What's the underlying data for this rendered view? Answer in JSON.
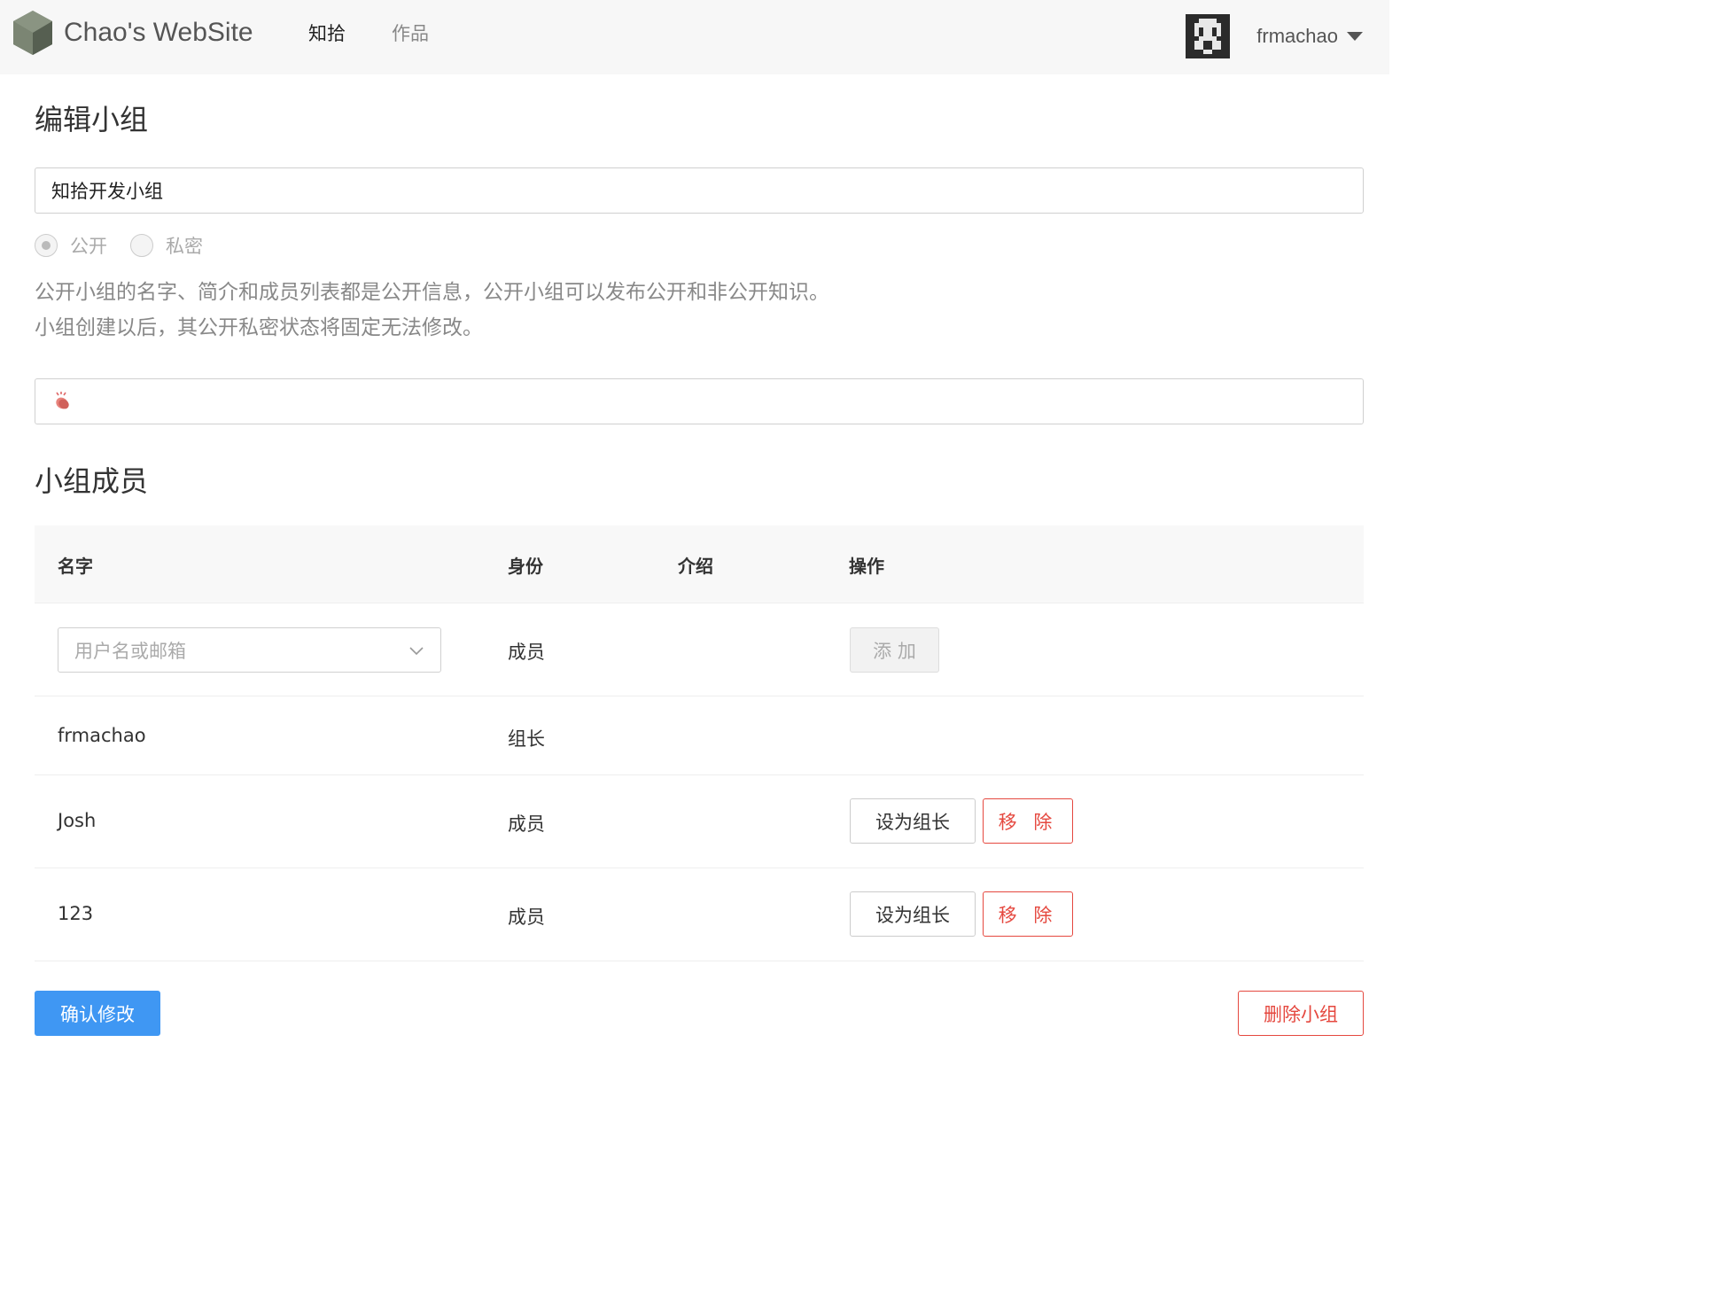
{
  "navbar": {
    "brand": "Chao's WebSite",
    "links": [
      {
        "label": "知拾",
        "active": true
      },
      {
        "label": "作品",
        "active": false
      }
    ],
    "username": "frmachao"
  },
  "form": {
    "title": "编辑小组",
    "group_name_value": "知拾开发小组",
    "visibility": {
      "options": [
        "公开",
        "私密"
      ],
      "selected": "公开",
      "disabled": true
    },
    "help_line_1": "公开小组的名字、简介和成员列表都是公开信息，公开小组可以发布公开和非公开知识。",
    "help_line_2": "小组创建以后，其公开私密状态将固定无法修改。",
    "description_icon": "clapping-hands-icon"
  },
  "members": {
    "title": "小组成员",
    "columns": [
      "名字",
      "身份",
      "介绍",
      "操作"
    ],
    "add_row": {
      "placeholder": "用户名或邮箱",
      "role": "成员",
      "add_label": "添 加"
    },
    "rows": [
      {
        "name": "frmachao",
        "role": "组长",
        "actions": []
      },
      {
        "name": "Josh",
        "role": "成员",
        "actions": [
          "设为组长",
          "移 除"
        ]
      },
      {
        "name": "123",
        "role": "成员",
        "actions": [
          "设为组长",
          "移 除"
        ]
      }
    ]
  },
  "footer": {
    "confirm_label": "确认修改",
    "delete_label": "删除小组"
  },
  "colors": {
    "primary": "#3f97f3",
    "danger": "#e5483f",
    "navbar_bg": "#f7f7f7"
  }
}
